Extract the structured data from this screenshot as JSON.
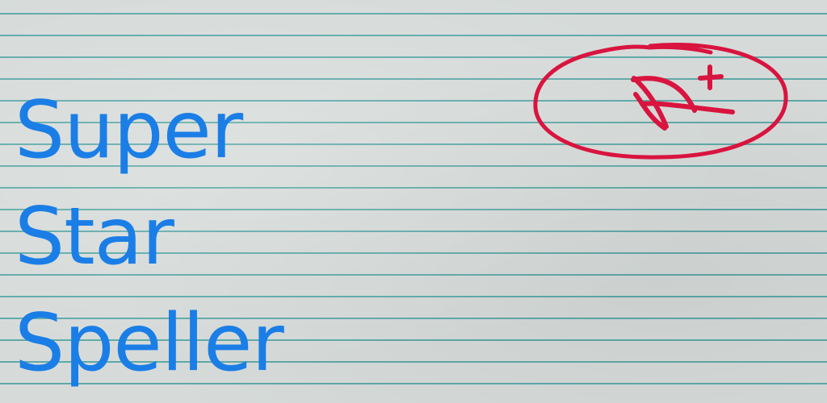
{
  "title_lines": [
    "Super",
    "Star",
    "Speller"
  ],
  "grade": {
    "label": "A+",
    "ink_color": "#d9143f"
  },
  "colors": {
    "text": "#1a7ee6",
    "paper": "#d6dbd9",
    "rule_lines": "#5fa9a8"
  }
}
